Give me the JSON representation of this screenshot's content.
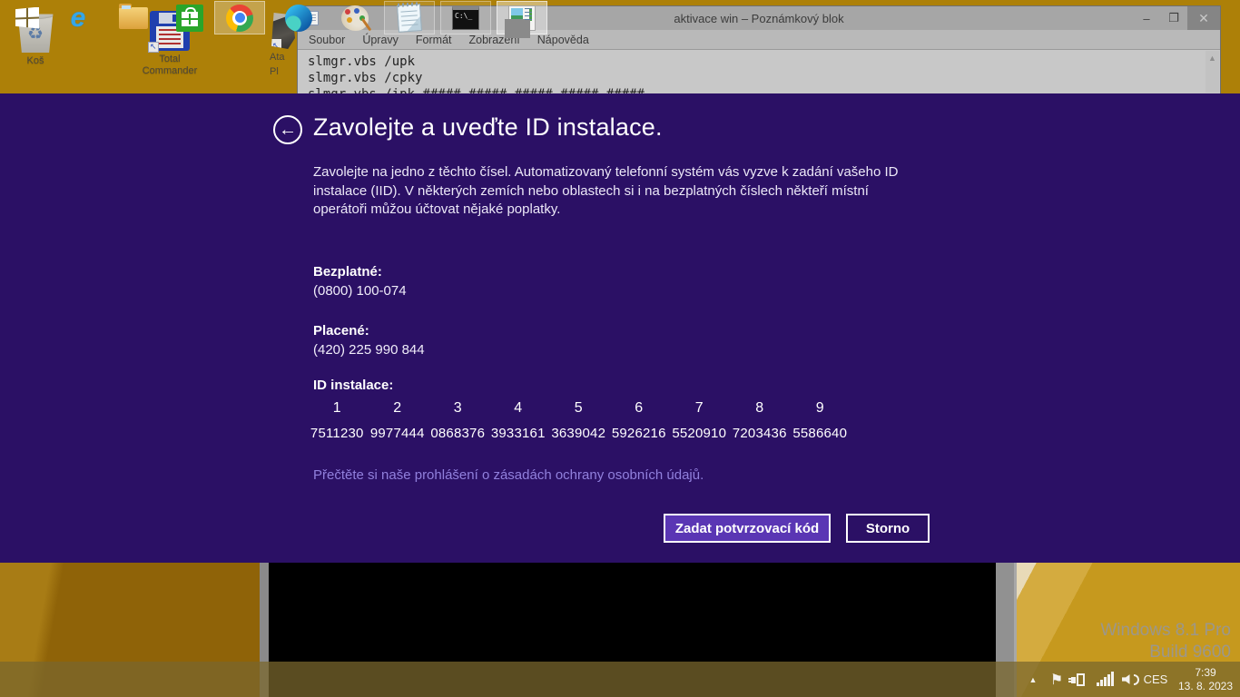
{
  "desktop": {
    "icons": [
      {
        "label": "Koš"
      },
      {
        "label_line1": "Total",
        "label_line2": "Commander"
      },
      {
        "label_line1": "Ata",
        "label_line2": "Pl"
      }
    ],
    "watermark": {
      "line1": "Windows 8.1 Pro",
      "line2": "Build 9600"
    }
  },
  "notepad": {
    "title": "aktivace win – Poznámkový blok",
    "menu": [
      "Soubor",
      "Úpravy",
      "Formát",
      "Zobrazení",
      "Nápověda"
    ],
    "lines": [
      "slmgr.vbs /upk",
      "slmgr.vbs /cpky",
      "slmgr.vbs /ipk #####-#####-#####-#####-#####"
    ],
    "controls": {
      "minimize": "–",
      "maximize": "❐",
      "close": "✕"
    },
    "scroll_up_arrow": "▲"
  },
  "activation": {
    "back_arrow": "←",
    "title": "Zavolejte a uveďte ID instalace.",
    "body": "Zavolejte na jedno z těchto čísel. Automatizovaný telefonní systém vás vyzve k zadání vašeho ID instalace (IID). V některých zemích nebo oblastech si i na bezplatných číslech někteří místní operátoři můžou účtovat nějaké poplatky.",
    "toll_free_label": "Bezplatné:",
    "toll_free_number": "(0800) 100-074",
    "paid_label": "Placené:",
    "paid_number": "(420) 225 990 844",
    "iid_label": "ID instalace:",
    "iid_groups": [
      {
        "index": "1",
        "value": "7511230"
      },
      {
        "index": "2",
        "value": "9977444"
      },
      {
        "index": "3",
        "value": "0868376"
      },
      {
        "index": "4",
        "value": "3933161"
      },
      {
        "index": "5",
        "value": "3639042"
      },
      {
        "index": "6",
        "value": "5926216"
      },
      {
        "index": "7",
        "value": "5520910"
      },
      {
        "index": "8",
        "value": "7203436"
      },
      {
        "index": "9",
        "value": "5586640"
      }
    ],
    "privacy_link": "Přečtěte si naše prohlášení o zásadách ochrany osobních údajů.",
    "confirm_button": "Zadat potvrzovací kód",
    "cancel_button": "Storno"
  },
  "taskbar": {
    "icons": [
      "start",
      "internet-explorer",
      "file-explorer",
      "windows-store",
      "chrome",
      "edge",
      "paint",
      "notepad",
      "command-prompt",
      "activation-app"
    ]
  },
  "tray": {
    "hidden_icons_arrow": "▲",
    "flag_glyph": "⚑",
    "language": "CES",
    "time": "7:39",
    "date": "13. 8. 2023"
  },
  "colors": {
    "overlay_bg": "#2b1065",
    "primary_button": "#5a36b4",
    "link": "#9180dd",
    "desktop_gold_top": "#ad8008",
    "desktop_gold_bottom_right": "#c6991e",
    "taskbar_tint": "rgba(122,102,45,0.74)"
  },
  "cmd_icon_text": "C:\\_"
}
